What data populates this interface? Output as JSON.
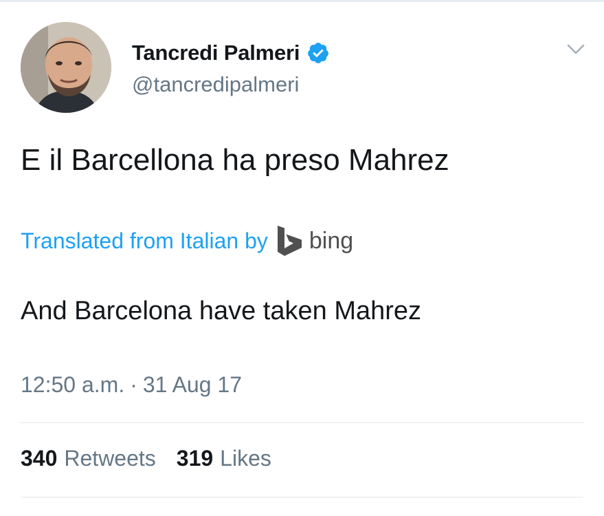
{
  "tweet": {
    "author": {
      "display_name": "Tancredi Palmeri",
      "handle": "@tancredipalmeri",
      "verified": true,
      "avatar_icon": "profile-photo"
    },
    "menu_icon": "chevron-down-icon",
    "text": "E il Barcellona ha preso Mahrez",
    "translation": {
      "label": "Translated from Italian by",
      "provider_logo": "bing-logo-icon",
      "provider_name": "bing",
      "text": "And Barcelona have taken Mahrez"
    },
    "timestamp": {
      "time": "12:50 a.m.",
      "separator": "·",
      "date": "31 Aug 17"
    },
    "stats": {
      "retweets_count": "340",
      "retweets_label": "Retweets",
      "likes_count": "319",
      "likes_label": "Likes"
    },
    "colors": {
      "link": "#1da1f2",
      "secondary_text": "#657786",
      "primary_text": "#14171a",
      "verified_badge": "#1da1f2",
      "divider": "#e1e8ed"
    }
  }
}
